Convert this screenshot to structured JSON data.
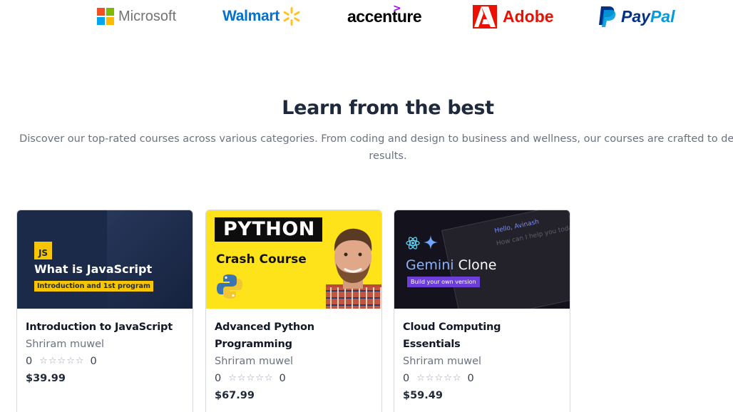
{
  "brand_logos": {
    "microsoft": "Microsoft",
    "walmart": "Walmart",
    "accenture": "accenture",
    "adobe": "Adobe",
    "paypal_pay": "Pay",
    "paypal_pal": "Pal"
  },
  "section": {
    "title": "Learn from the best",
    "description_line1": "Discover our top-rated courses across various categories. From coding and design to business and wellness, our courses are crafted to deliver",
    "description_line2": "results."
  },
  "courses": [
    {
      "thumb": {
        "badge": "JS",
        "heading": "What is JavaScript",
        "subheading": "Introduction and 1st program"
      },
      "title": "Introduction to JavaScript",
      "author": "Shriram muwel",
      "rating": "0",
      "stars": "☆☆☆☆☆",
      "rating_count": "0",
      "price": "$39.99"
    },
    {
      "thumb": {
        "heading": "PYTHON",
        "subheading": "Crash Course"
      },
      "title": "Advanced Python Programming",
      "author": "Shriram muwel",
      "rating": "0",
      "stars": "☆☆☆☆☆",
      "rating_count": "0",
      "price": "$67.99"
    },
    {
      "thumb": {
        "heading_part1": "Gemini",
        "heading_part2": " Clone",
        "button": "Build your own version",
        "greeting": "Hello, Avinash",
        "prompt": "How can I help you today?"
      },
      "title": "Cloud Computing Essentials",
      "author": "Shriram muwel",
      "rating": "0",
      "stars": "☆☆☆☆☆",
      "rating_count": "0",
      "price": "$59.49"
    }
  ],
  "colors": {
    "microsoft_red": "#f25022",
    "microsoft_green": "#7fba00",
    "microsoft_blue": "#00a4ef",
    "microsoft_yellow": "#ffb900",
    "walmart_blue": "#0071ce",
    "walmart_spark": "#ffc220",
    "accenture_purple": "#a100ff",
    "adobe_red": "#eb1000",
    "paypal_dark": "#003087",
    "paypal_light": "#009cde"
  }
}
